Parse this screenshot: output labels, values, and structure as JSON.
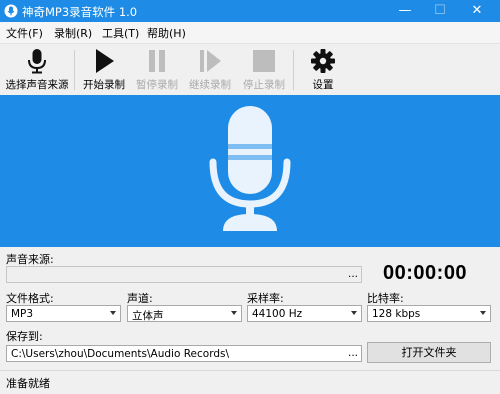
{
  "window": {
    "title": "神奇MP3录音软件 1.0",
    "minimize_glyph": "—",
    "maximize_glyph": "☐",
    "close_glyph": "✕"
  },
  "menu": [
    "文件(F)",
    "录制(R)",
    "工具(T)",
    "帮助(H)"
  ],
  "toolbar": {
    "select_source": "选择声音来源",
    "start": "开始录制",
    "pause": "暂停录制",
    "resume": "继续录制",
    "stop": "停止录制",
    "settings": "设置"
  },
  "colors": {
    "accent": "#1e8ce6",
    "mic_light": "#e8f3fd",
    "mic_stripe": "#7fbef2"
  },
  "icons": {
    "app": "app-icon",
    "select_source": "microphone-icon",
    "start": "play-icon",
    "pause": "pause-icon",
    "resume": "resume-icon",
    "stop": "stop-icon",
    "settings": "gear-icon",
    "banner": "microphone-graphic"
  },
  "form": {
    "source_label": "声音来源:",
    "source_value": "",
    "browse_dots": "...",
    "timer": "00:00:00",
    "format_label": "文件格式:",
    "format_value": "MP3",
    "channel_label": "声道:",
    "channel_value": "立体声",
    "samplerate_label": "采样率:",
    "samplerate_value": "44100 Hz",
    "bitrate_label": "比特率:",
    "bitrate_value": "128 kbps",
    "saveto_label": "保存到:",
    "saveto_value": "C:\\Users\\zhou\\Documents\\Audio Records\\",
    "open_folder": "打开文件夹"
  },
  "status": "准备就绪"
}
